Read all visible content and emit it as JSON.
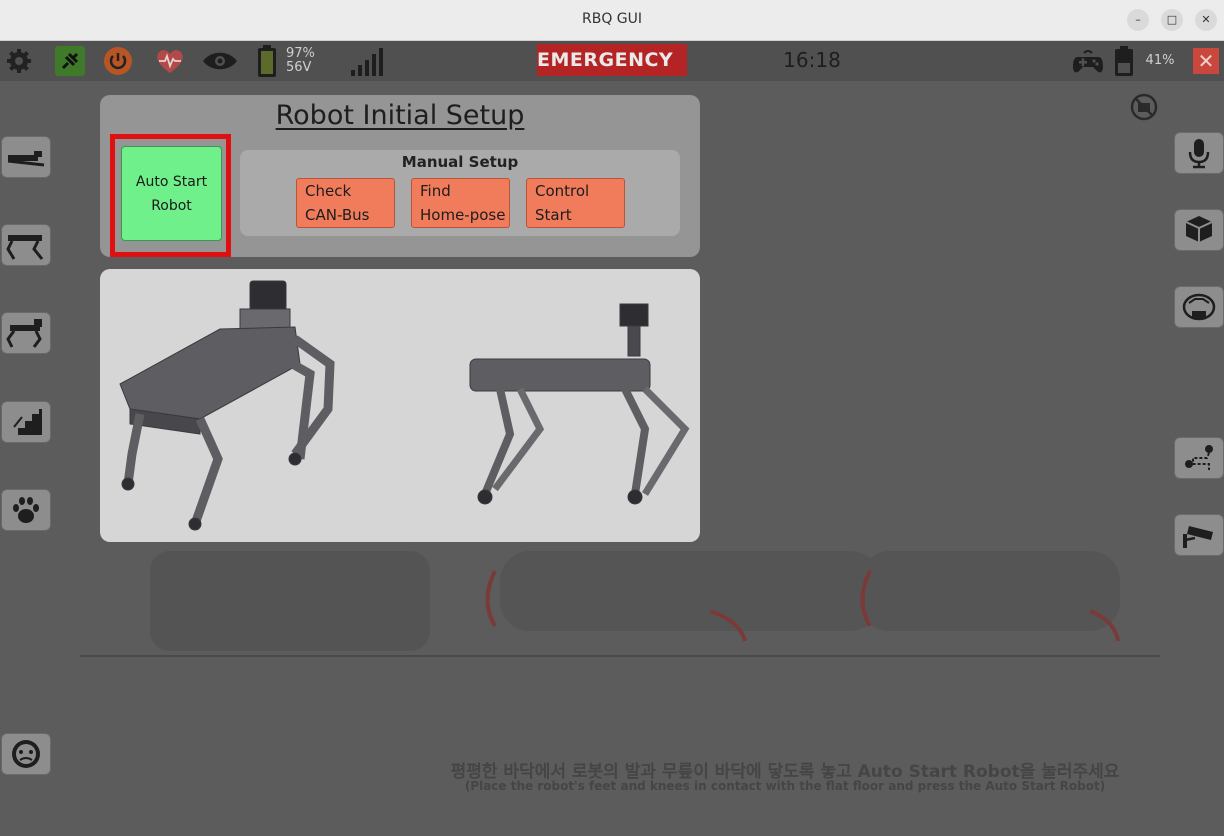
{
  "window": {
    "title": "RBQ GUI",
    "minimize": "–",
    "maximize": "□",
    "close": "✕"
  },
  "status": {
    "battery_percent": "97%",
    "battery_voltage": "56V",
    "emergency_label": "- EMERGENCY -",
    "clock": "16:18",
    "controller_battery": "41%",
    "close_label": "✕"
  },
  "setup": {
    "title": "Robot Initial Setup",
    "auto_start_label": "Auto Start\nRobot",
    "manual_setup_label": "Manual Setup",
    "manual_buttons": [
      {
        "label": "Check\nCAN-Bus"
      },
      {
        "label": "Find\nHome-pose"
      },
      {
        "label": "Control\nStart"
      }
    ]
  },
  "instructions": {
    "korean": "평평한 바닥에서 로봇의 발과 무릎이 바닥에 닿도록 놓고 Auto Start Robot을 눌러주세요",
    "english": "(Place the robot's feet and knees in contact with the flat floor and press the Auto Start Robot)"
  },
  "colors": {
    "emergency": "#b52424",
    "auto_start": "#6ff08a",
    "manual_button": "#f07c5c",
    "highlight": "#e01010"
  }
}
